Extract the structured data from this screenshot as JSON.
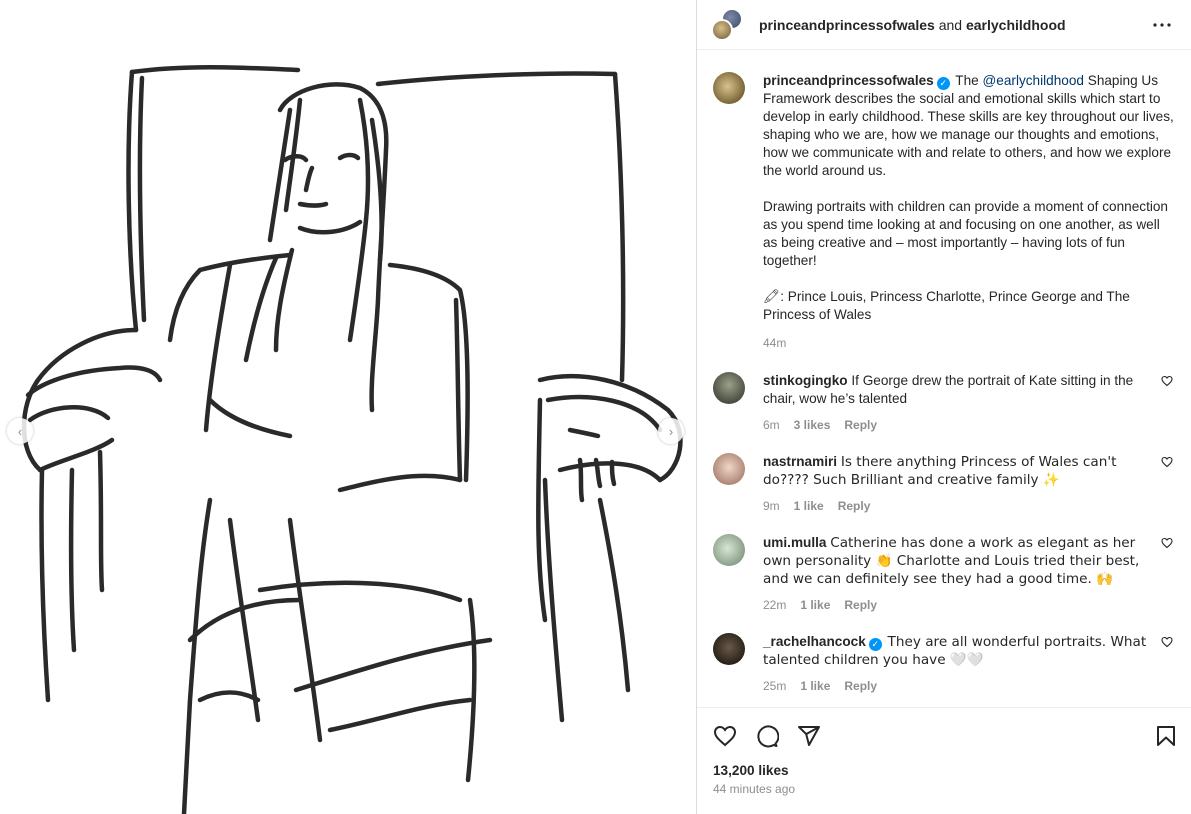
{
  "header": {
    "account1": "princeandprincessofwales",
    "joiner": "and",
    "account2": "earlychildhood",
    "more_icon": "more-horizontal-icon"
  },
  "media": {
    "prev_icon": "‹",
    "next_icon": "›"
  },
  "caption": {
    "username": "princeandprincessofwales",
    "verified_icon": "✓",
    "lead": "The",
    "mention": "@earlychildhood",
    "p1_rest": "Shaping Us Framework describes the social and emotional skills which start to develop in early childhood. These skills are key throughout our lives, shaping who we are, how we manage our thoughts and emotions, how we communicate with and relate to others, and how we explore the world around us.",
    "p2": "Drawing portraits with children can provide a moment of connection as you spend time looking at and focusing on one another, as well as being creative and – most importantly – having lots of fun together!",
    "p3": "🖍: Prince Louis, Princess Charlotte, Prince George and The Princess of Wales",
    "time": "44m"
  },
  "comments": [
    {
      "username": "stinkogingko",
      "verified": false,
      "text": "If George drew the portrait of Kate sitting in the chair, wow he’s talented",
      "time": "6m",
      "likes": "3 likes",
      "reply": "Reply"
    },
    {
      "username": "nastrnamiri",
      "verified": false,
      "text": "Is there anything Princess of Wales can't do???? Such Brilliant and creative family ✨",
      "time": "9m",
      "likes": "1 like",
      "reply": "Reply"
    },
    {
      "username": "umi.mulla",
      "verified": false,
      "text": "Catherine has done a work as elegant as her own personality 👏 Charlotte and Louis tried their best, and we can definitely see they had a good time. 🙌",
      "time": "22m",
      "likes": "1 like",
      "reply": "Reply"
    },
    {
      "username": "_rachelhancock",
      "verified": true,
      "text": "They are all wonderful portraits. What talented children you have 🤍🤍",
      "time": "25m",
      "likes": "1 like",
      "reply": "Reply"
    }
  ],
  "actions": {
    "like_icon": "heart-icon",
    "comment_icon": "comment-icon",
    "share_icon": "paper-plane-icon",
    "save_icon": "bookmark-icon"
  },
  "footer": {
    "likes_total": "13,200 likes",
    "posted": "44 minutes ago"
  }
}
